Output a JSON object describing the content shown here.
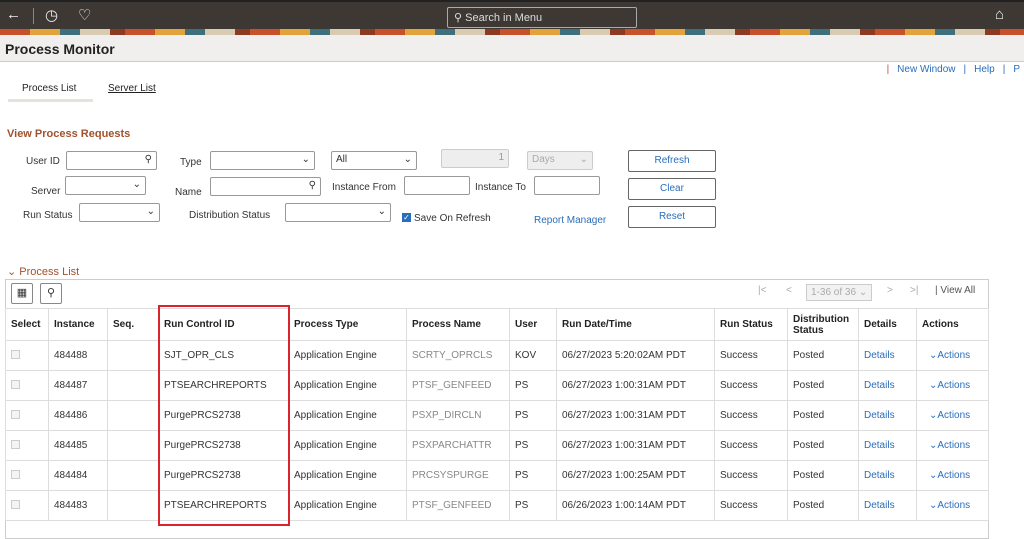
{
  "header": {
    "search_placeholder": "Search in Menu"
  },
  "page_title": "Process Monitor",
  "links": [
    "New Window",
    "Help",
    "P"
  ],
  "tabs": [
    "Process List",
    "Server List"
  ],
  "form": {
    "section_title": "View Process Requests",
    "user_id": "User ID",
    "type": "Type",
    "all": "All",
    "num": "1",
    "days": "Days",
    "server": "Server",
    "name": "Name",
    "instance_from": "Instance From",
    "instance_to": "Instance To",
    "run_status": "Run Status",
    "distribution_status": "Distribution Status",
    "save_on_refresh": "Save On Refresh",
    "report_manager": "Report Manager",
    "refresh": "Refresh",
    "clear": "Clear",
    "reset": "Reset"
  },
  "process_list": {
    "title": "Process List",
    "pager": "1-36 of 36",
    "view_all": "View All",
    "columns": [
      "Select",
      "Instance",
      "Seq.",
      "Run Control ID",
      "Process Type",
      "Process Name",
      "User",
      "Run Date/Time",
      "Run Status",
      "Distribution Status",
      "Details",
      "Actions"
    ],
    "rows": [
      [
        "484488",
        "",
        "SJT_OPR_CLS",
        "Application Engine",
        "SCRTY_OPRCLS",
        "KOV",
        "06/27/2023  5:20:02AM PDT",
        "Success",
        "Posted",
        "Details",
        "Actions"
      ],
      [
        "484487",
        "",
        "PTSEARCHREPORTS",
        "Application Engine",
        "PTSF_GENFEED",
        "PS",
        "06/27/2023  1:00:31AM PDT",
        "Success",
        "Posted",
        "Details",
        "Actions"
      ],
      [
        "484486",
        "",
        "PurgePRCS2738",
        "Application Engine",
        "PSXP_DIRCLN",
        "PS",
        "06/27/2023  1:00:31AM PDT",
        "Success",
        "Posted",
        "Details",
        "Actions"
      ],
      [
        "484485",
        "",
        "PurgePRCS2738",
        "Application Engine",
        "PSXPARCHATTR",
        "PS",
        "06/27/2023  1:00:31AM PDT",
        "Success",
        "Posted",
        "Details",
        "Actions"
      ],
      [
        "484484",
        "",
        "PurgePRCS2738",
        "Application Engine",
        "PRCSYSPURGE",
        "PS",
        "06/27/2023  1:00:25AM PDT",
        "Success",
        "Posted",
        "Details",
        "Actions"
      ],
      [
        "484483",
        "",
        "PTSEARCHREPORTS",
        "Application Engine",
        "PTSF_GENFEED",
        "PS",
        "06/26/2023  1:00:14AM PDT",
        "Success",
        "Posted",
        "Details",
        "Actions"
      ]
    ]
  }
}
